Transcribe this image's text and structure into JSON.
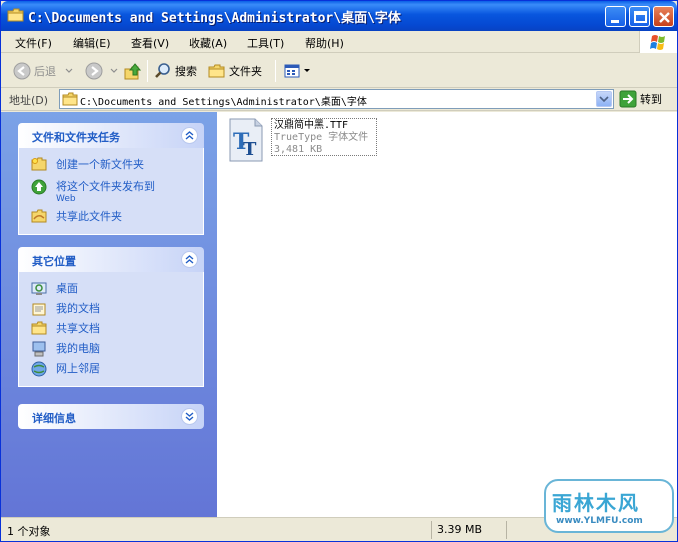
{
  "window": {
    "title": "C:\\Documents and Settings\\Administrator\\桌面\\字体"
  },
  "menu": [
    "文件(F)",
    "编辑(E)",
    "查看(V)",
    "收藏(A)",
    "工具(T)",
    "帮助(H)"
  ],
  "toolbar": {
    "back_label": "后退",
    "search_label": "搜索",
    "folders_label": "文件夹"
  },
  "address": {
    "label": "地址(D)",
    "path": "C:\\Documents and Settings\\Administrator\\桌面\\字体",
    "go_label": "转到"
  },
  "tasks_panel": {
    "title": "文件和文件夹任务",
    "items": [
      {
        "label": "创建一个新文件夹",
        "icon": "new-folder-icon"
      },
      {
        "label": "将这个文件夹发布到",
        "sub": "Web",
        "icon": "publish-web-icon"
      },
      {
        "label": "共享此文件夹",
        "icon": "share-folder-icon"
      }
    ]
  },
  "places_panel": {
    "title": "其它位置",
    "items": [
      {
        "label": "桌面",
        "icon": "desktop-icon"
      },
      {
        "label": "我的文档",
        "icon": "my-documents-icon"
      },
      {
        "label": "共享文档",
        "icon": "shared-documents-icon"
      },
      {
        "label": "我的电脑",
        "icon": "my-computer-icon"
      },
      {
        "label": "网上邻居",
        "icon": "network-places-icon"
      }
    ]
  },
  "details_panel": {
    "title": "详细信息"
  },
  "file": {
    "name": "汉鼎简中黑.TTF",
    "type": "TrueType 字体文件",
    "size": "3,481 KB",
    "icon": "truetype-font-icon"
  },
  "status": {
    "objects": "1 个对象",
    "size": "3.39 MB"
  },
  "watermark": {
    "logo": "雨林木风",
    "url": "www.YLMFU.com"
  },
  "colors": {
    "titlebar": "#0855DD",
    "taskpane": "#6F8FE0",
    "task_link": "#215DC6"
  }
}
